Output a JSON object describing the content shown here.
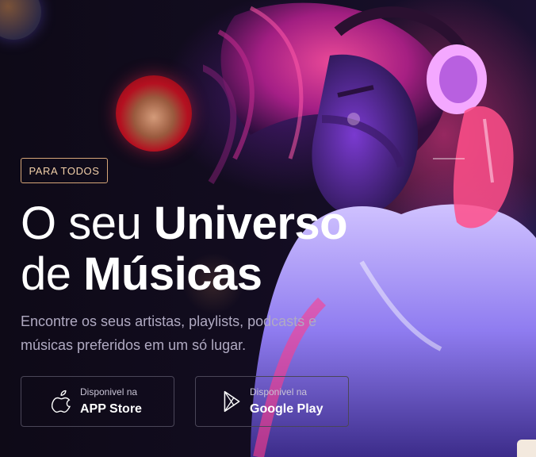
{
  "hero": {
    "tag": "PARA TODOS",
    "headline": {
      "line1_light": "O seu",
      "line1_bold": "Universo",
      "line2_light": "de",
      "line2_bold": "Músicas"
    },
    "subtitle": "Encontre os seus artistas, playlists, podcasts e músicas preferidos em um só lugar."
  },
  "stores": [
    {
      "small": "Disponivel na",
      "big": "APP Store",
      "icon": "apple-icon"
    },
    {
      "small": "Disponivel na",
      "big": "Google Play",
      "icon": "google-play-icon"
    }
  ],
  "colors": {
    "background": "#0e0a17",
    "tag_border": "#d6a678",
    "tag_text": "#f2cfa8",
    "subtitle": "#b0aac2",
    "accent_pink": "#ff3c8c",
    "accent_violet": "#6e5aff"
  }
}
